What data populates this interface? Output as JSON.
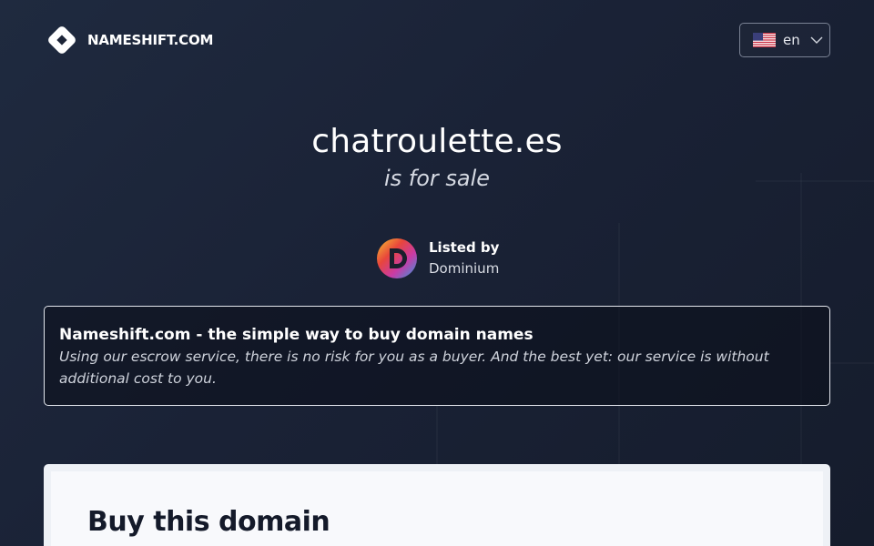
{
  "header": {
    "logo_text": "NAMESHIFT.COM",
    "logo_icon": "nameshift-diamond-logo",
    "language": {
      "label": "en",
      "flag": "us-flag-icon"
    }
  },
  "hero": {
    "domain": "chatroulette.es",
    "subtitle": "is for sale"
  },
  "seller": {
    "caption": "Listed by",
    "name": "Dominium"
  },
  "info": {
    "title": "Nameshift.com - the simple way to buy domain names",
    "description": "Using our escrow service, there is no risk for you as a buyer. And the best yet: our service is without additional cost to you."
  },
  "buy": {
    "title": "Buy this domain"
  },
  "colors": {
    "background": "#1a2236",
    "card": "#f8f9fc",
    "text_dark": "#141a2a"
  }
}
